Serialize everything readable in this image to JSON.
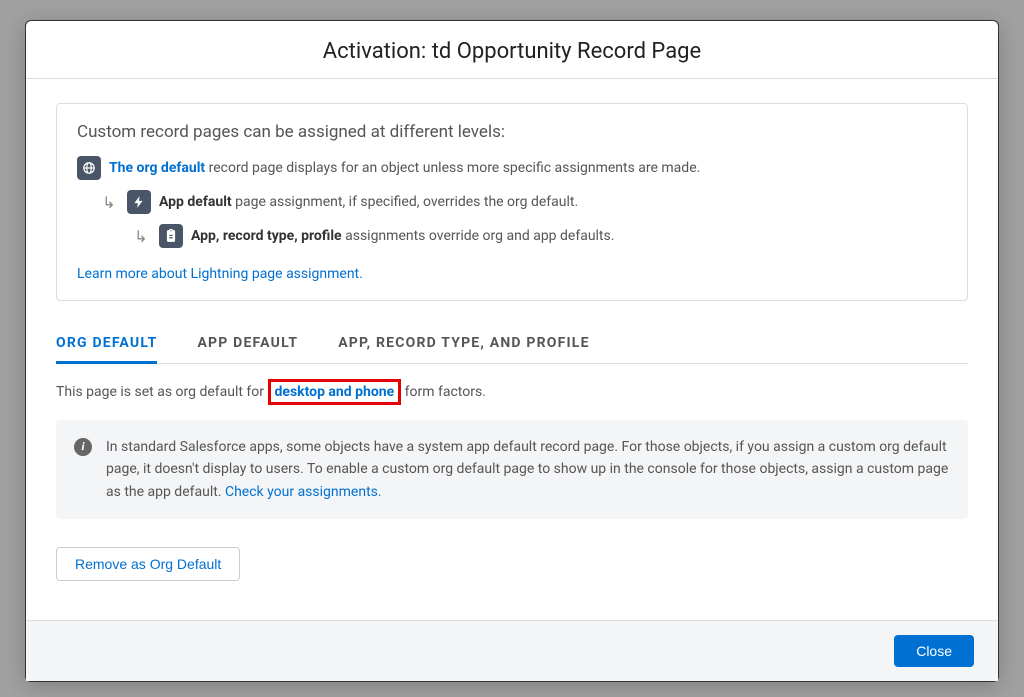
{
  "modal": {
    "title": "Activation: td Opportunity Record Page"
  },
  "info": {
    "heading": "Custom record pages can be assigned at different levels:",
    "level1": {
      "bold": "The org default",
      "rest": " record page displays for an object unless more specific assignments are made."
    },
    "level2": {
      "bold": "App default",
      "rest": " page assignment, if specified, overrides the org default."
    },
    "level3": {
      "bold": "App, record type, profile",
      "rest": " assignments override org and app defaults."
    },
    "learn": "Learn more about Lightning page assignment."
  },
  "tabs": {
    "org": "ORG DEFAULT",
    "app": "APP DEFAULT",
    "profile": "APP, RECORD TYPE, AND PROFILE"
  },
  "status": {
    "prefix": "This page is set as org default for ",
    "highlight": "desktop and phone",
    "suffix": " form factors."
  },
  "note": {
    "text": "In standard Salesforce apps, some objects have a system app default record page. For those objects, if you assign a custom org default page, it doesn't display to users. To enable a custom org default page to show up in the console for those objects, assign a custom page as the app default.  ",
    "link": "Check your assignments."
  },
  "buttons": {
    "remove": "Remove as Org Default",
    "close": "Close"
  }
}
